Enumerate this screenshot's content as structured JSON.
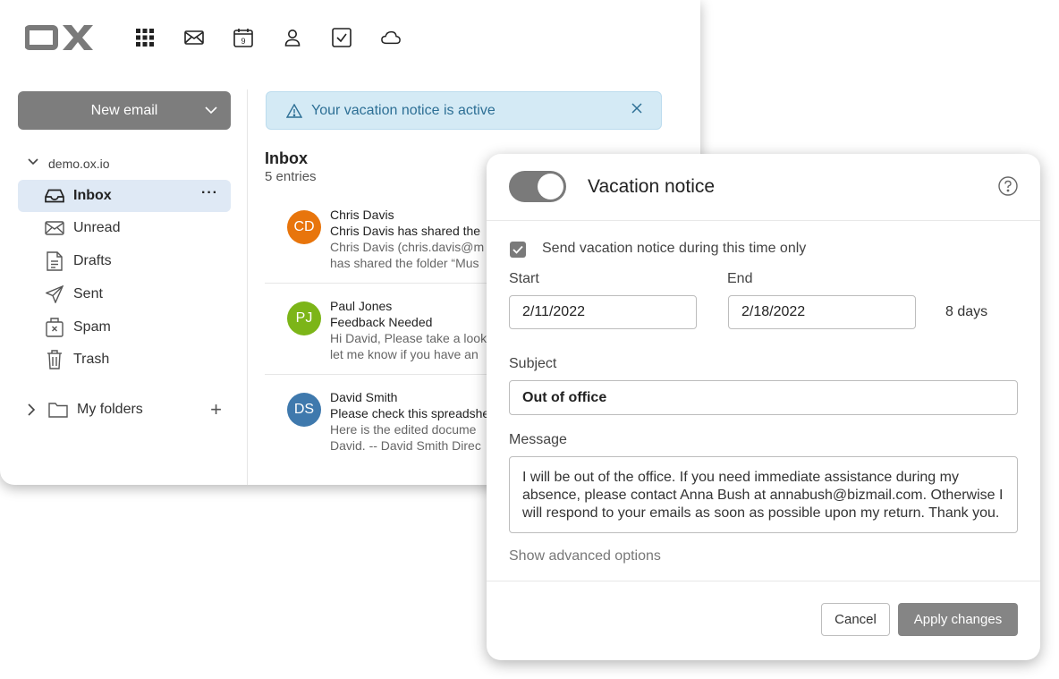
{
  "brand": {
    "logo_text": "OX"
  },
  "nav": {
    "icons": [
      "apps-grid-icon",
      "mail-icon",
      "calendar-icon",
      "contacts-icon",
      "tasks-icon",
      "drive-cloud-icon"
    ],
    "calendar_day": "9"
  },
  "sidebar": {
    "new_email_label": "New email",
    "account": "demo.ox.io",
    "folders": [
      {
        "label": "Inbox",
        "icon": "inbox-icon",
        "active": true
      },
      {
        "label": "Unread",
        "icon": "envelope-icon",
        "active": false
      },
      {
        "label": "Drafts",
        "icon": "document-icon",
        "active": false
      },
      {
        "label": "Sent",
        "icon": "paper-plane-icon",
        "active": false
      },
      {
        "label": "Spam",
        "icon": "spam-icon",
        "active": false
      },
      {
        "label": "Trash",
        "icon": "trash-icon",
        "active": false
      }
    ],
    "more_label": "···",
    "my_folders_label": "My folders",
    "add_label": "+"
  },
  "notice": {
    "text": "Your vacation notice is active"
  },
  "list": {
    "title": "Inbox",
    "count": "5 entries",
    "messages": [
      {
        "initials": "CD",
        "color": "#e8750c",
        "from": "Chris Davis",
        "subject": "Chris Davis has shared the",
        "preview1": "Chris Davis (chris.davis@m",
        "preview2": "has shared the folder “Mus"
      },
      {
        "initials": "PJ",
        "color": "#7cb518",
        "from": "Paul Jones",
        "subject": "Feedback Needed",
        "preview1": "Hi David, Please take a look",
        "preview2": "let me know if you have an"
      },
      {
        "initials": "DS",
        "color": "#3f79ad",
        "from": "David Smith",
        "subject": "Please check this spreadshe",
        "preview1": "Here is the edited docume",
        "preview2": "David. -- David Smith Direc"
      }
    ]
  },
  "dialog": {
    "title": "Vacation notice",
    "toggle_on": true,
    "time_only_label": "Send vacation notice during this time only",
    "time_only_checked": true,
    "start_label": "Start",
    "start_value": "2/11/2022",
    "end_label": "End",
    "end_value": "2/18/2022",
    "days": "8 days",
    "subject_label": "Subject",
    "subject_value": "Out of office",
    "message_label": "Message",
    "message_value": "I will be out of the office. If you need immediate assistance during my absence, please contact Anna Bush at annabush@bizmail.com. Otherwise I will respond to your emails as soon as possible upon my return. Thank you.",
    "advanced_label": "Show advanced options",
    "cancel_label": "Cancel",
    "apply_label": "Apply changes"
  }
}
